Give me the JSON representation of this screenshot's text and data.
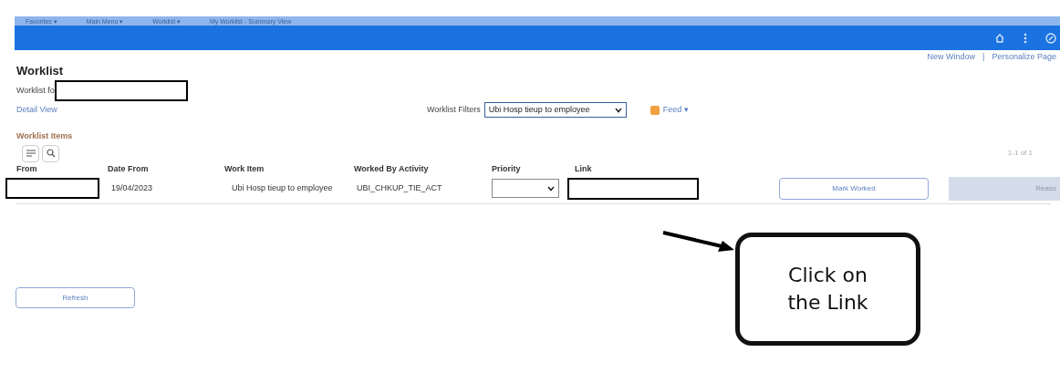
{
  "menu": [
    "Favorites ▾",
    "Main Menu ▾",
    "Worklist ▾",
    "My Worklist - Summary View"
  ],
  "top_links": [
    "New Window",
    "|",
    "Personalize Page"
  ],
  "title": "Worklist",
  "worklist_for": "Worklist fo",
  "detail_view": "Detail View",
  "filter": {
    "label": "Worklist Filters",
    "value": "Ubi Hosp tieup to employee"
  },
  "feed": "Feed ▾",
  "section": "Worklist Items",
  "pager": "1-1 of 1",
  "columns": [
    "From",
    "Date From",
    "Work Item",
    "Worked By Activity",
    "Priority",
    "Link"
  ],
  "rows": [
    {
      "date": "19/04/2023",
      "work_item": "Ubi Hosp tieup to employee",
      "activity": "UBI_CHKUP_TIE_ACT",
      "mark": "Mark Worked",
      "reassign": "Reass"
    }
  ],
  "refresh": "Refresh",
  "callout": "Click on the Link"
}
